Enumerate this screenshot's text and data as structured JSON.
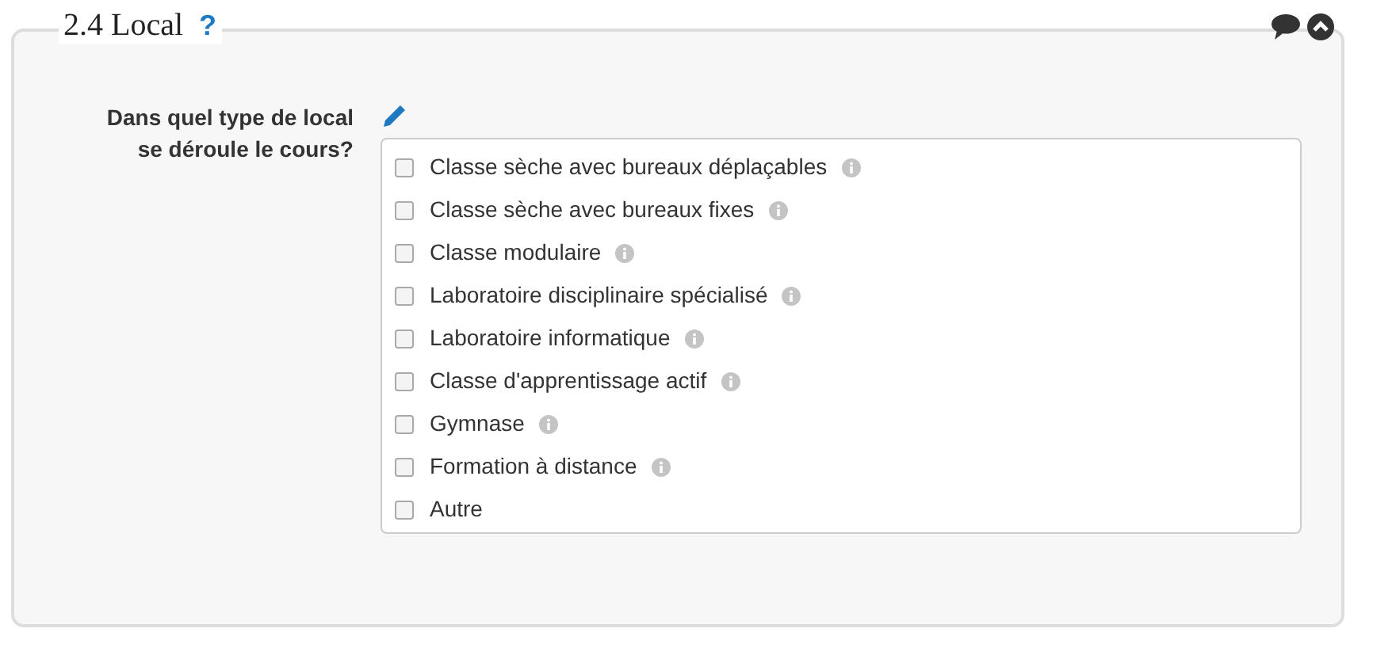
{
  "section": {
    "title": "2.4 Local",
    "help": "?"
  },
  "question": {
    "label": "Dans quel type de local se déroule le cours?"
  },
  "options": [
    {
      "label": "Classe sèche avec bureaux déplaçables",
      "checked": false,
      "info": true
    },
    {
      "label": "Classe sèche avec bureaux fixes",
      "checked": false,
      "info": true
    },
    {
      "label": "Classe modulaire",
      "checked": false,
      "info": true
    },
    {
      "label": "Laboratoire disciplinaire spécialisé",
      "checked": false,
      "info": true
    },
    {
      "label": "Laboratoire informatique",
      "checked": false,
      "info": true
    },
    {
      "label": "Classe d'apprentissage actif",
      "checked": false,
      "info": true
    },
    {
      "label": "Gymnase",
      "checked": false,
      "info": true
    },
    {
      "label": "Formation à distance",
      "checked": false,
      "info": true
    },
    {
      "label": "Autre",
      "checked": false,
      "info": false
    }
  ]
}
